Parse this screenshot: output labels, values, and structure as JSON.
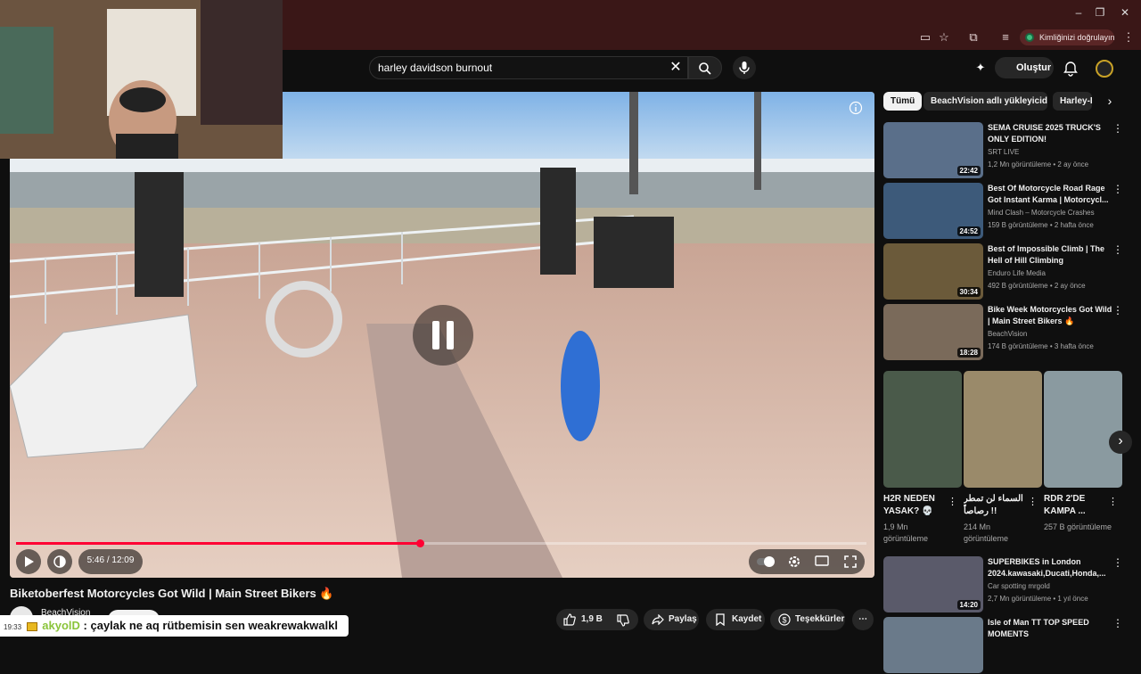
{
  "browser": {
    "profile_label": "Kimliğinizi doğrulayın",
    "colors": {
      "frame": "#3a1717",
      "profile_dot": "#3fbf7f"
    }
  },
  "header": {
    "search_value": "harley davidson burnout",
    "create_label": "Oluştur"
  },
  "player": {
    "time": "5:46 / 12:09",
    "progress": 0.475,
    "state": "paused"
  },
  "video": {
    "title": "Biketoberfest Motorcycles Got Wild | Main Street Bikers 🔥",
    "channel": "BeachVision",
    "likes": "1,9 B",
    "share_label": "Paylaş",
    "save_label": "Kaydet",
    "thanks_label": "Teşekkürler"
  },
  "chat_overlay": {
    "time": "19:33",
    "user": "akyolD",
    "message": ": çaylak ne aq rütbemisin sen weakrewakwalkl"
  },
  "filter_chips": [
    "Tümü",
    "BeachVision adlı yükleyiciden",
    "Harley-D"
  ],
  "recommendations": [
    {
      "title": "SEMA CRUISE 2025 TRUCK'S ONLY EDITION!",
      "channel": "SRT LIVE",
      "meta": "1,2 Mn görüntüleme • 2 ay önce",
      "duration": "22:42",
      "thumb_color": "#5a6f8a"
    },
    {
      "title": "Best Of Motorcycle Road Rage Got Instant Karma | Motorcycl...",
      "channel": "Mind Clash – Motorcycle Crashes",
      "meta": "159 B görüntüleme • 2 hafta önce",
      "duration": "24:52",
      "thumb_color": "#3d5a7a"
    },
    {
      "title": "Best of Impossible Climb | The Hell of Hill Climbing",
      "channel": "Enduro Life Media",
      "meta": "492 B görüntüleme • 2 ay önce",
      "duration": "30:34",
      "thumb_color": "#6b5a3a"
    },
    {
      "title": "Bike Week Motorcycles Got Wild | Main Street Bikers 🔥",
      "channel": "BeachVision",
      "meta": "174 B görüntüleme • 3 hafta önce",
      "duration": "18:28",
      "thumb_color": "#7a6a5a"
    }
  ],
  "shorts": [
    {
      "title": "H2R NEDEN YASAK? 💀",
      "views": "1,9 Mn görüntüleme",
      "thumb_color": "#4a5a4a"
    },
    {
      "title": "السماء لن تمطر رصاصاً !!",
      "views": "214 Mn görüntüleme",
      "thumb_color": "#9a8a6a"
    },
    {
      "title": "RDR 2'DE KAMPA ...",
      "views": "257 B görüntüleme",
      "thumb_color": "#8a9aa0"
    }
  ],
  "recommendations_more": [
    {
      "title": "SUPERBIKES in London 2024.kawasaki,Ducati,Honda,...",
      "channel": "Car spotting mrgold",
      "meta": "2,7 Mn görüntüleme • 1 yıl önce",
      "duration": "14:20",
      "thumb_color": "#5a5a6a"
    },
    {
      "title": "Isle of Man TT TOP SPEED MOMENTS",
      "channel": "",
      "meta": "",
      "duration": "",
      "thumb_color": "#6a7a8a"
    }
  ]
}
